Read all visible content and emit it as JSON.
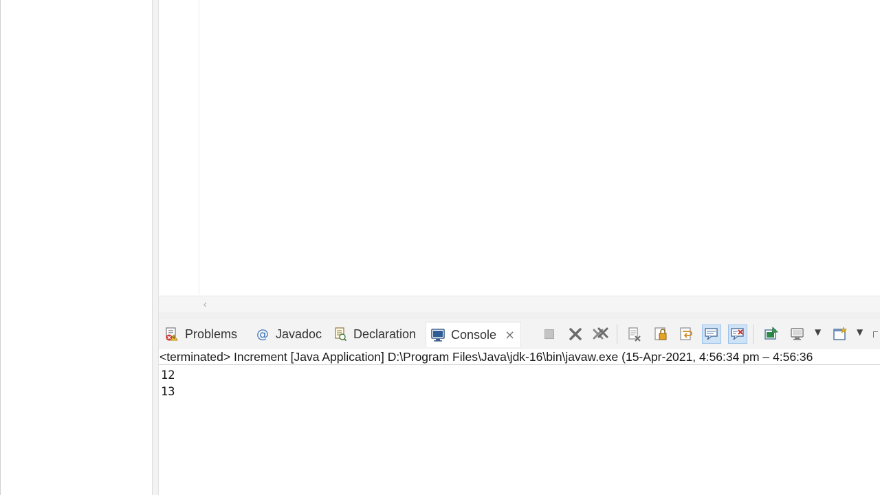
{
  "tabs": {
    "problems": "Problems",
    "javadoc": "Javadoc",
    "declaration": "Declaration",
    "console": "Console"
  },
  "console": {
    "status": "<terminated> Increment [Java Application] D:\\Program Files\\Java\\jdk-16\\bin\\javaw.exe  (15-Apr-2021, 4:56:34 pm – 4:56:36",
    "output": [
      "12",
      "13"
    ]
  },
  "icons": {
    "problems": "problems-icon",
    "javadoc": "at-icon",
    "declaration": "declaration-icon",
    "console": "console-icon"
  },
  "colors": {
    "accent": "#3b73b9",
    "pressed_bg": "#cfe3f7",
    "error_red": "#d03030"
  }
}
